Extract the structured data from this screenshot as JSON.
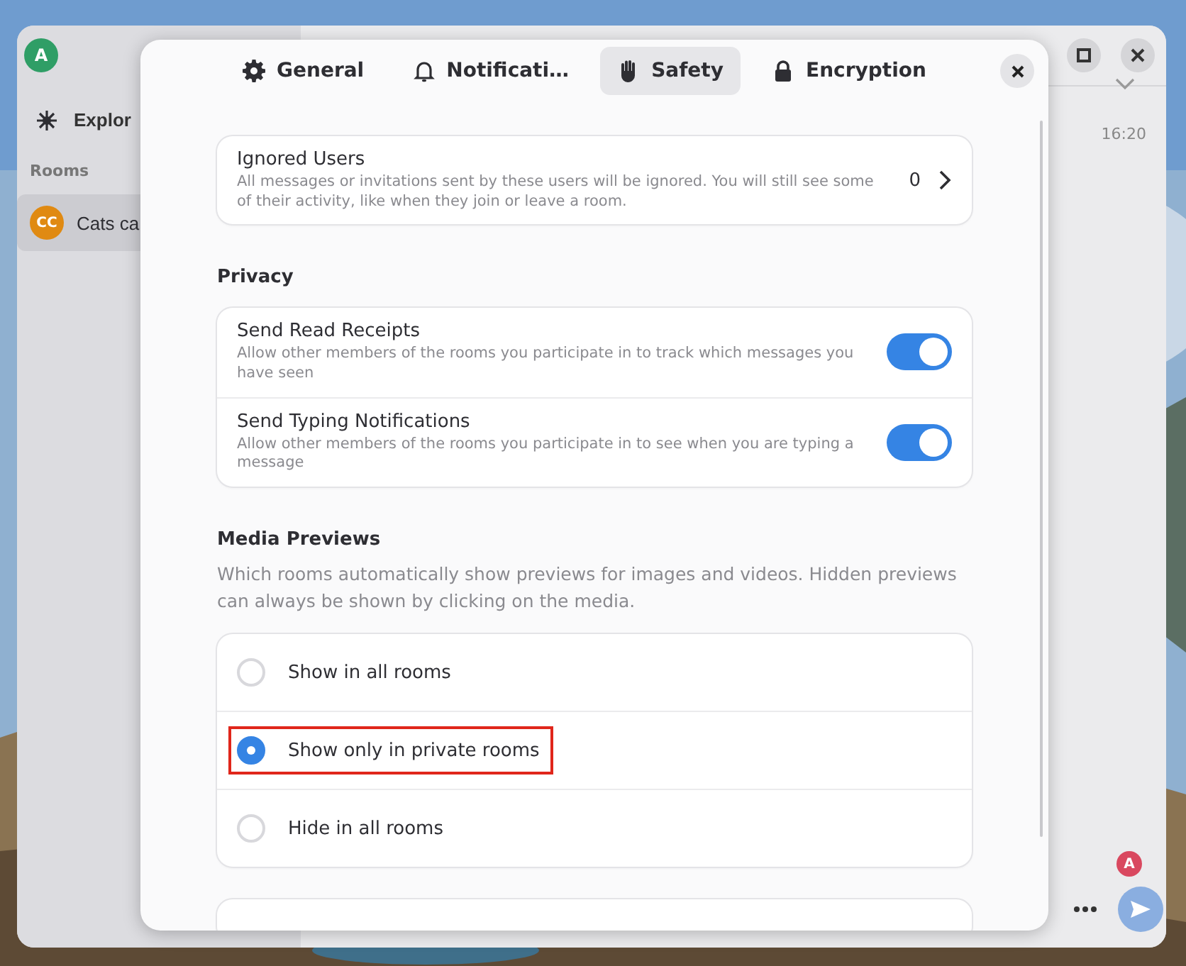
{
  "sidebar": {
    "avatar": "A",
    "explore": "Explor",
    "section": "Rooms",
    "rooms": [
      {
        "initials": "CC",
        "name": "Cats ca",
        "selected": true
      }
    ]
  },
  "chat": {
    "time": "16:20",
    "avatar": "A"
  },
  "dialog": {
    "tabs": [
      {
        "label": "General",
        "kind": "gear",
        "selected": false
      },
      {
        "label": "Notificati…",
        "kind": "bell",
        "selected": false
      },
      {
        "label": "Safety",
        "kind": "hand",
        "selected": true
      },
      {
        "label": "Encryption",
        "kind": "lock",
        "selected": false
      }
    ],
    "ignored": {
      "title": "Ignored Users",
      "subtitle": "All messages or invitations sent by these users will be ignored. You will still see some of their activity, like when they join or leave a room.",
      "count": "0"
    },
    "privacy": {
      "heading": "Privacy",
      "items": [
        {
          "title": "Send Read Receipts",
          "subtitle": "Allow other members of the rooms you participate in to track which messages you have seen",
          "on": true
        },
        {
          "title": "Send Typing Notifications",
          "subtitle": "Allow other members of the rooms you participate in to see when you are typing a message",
          "on": true
        }
      ]
    },
    "media": {
      "heading": "Media Previews",
      "description": "Which rooms automatically show previews for images and videos. Hidden previews can always be shown by clicking on the media.",
      "options": [
        {
          "label": "Show in all rooms",
          "selected": false,
          "highlighted": false
        },
        {
          "label": "Show only in private rooms",
          "selected": true,
          "highlighted": true
        },
        {
          "label": "Hide in all rooms",
          "selected": false,
          "highlighted": false
        }
      ]
    }
  }
}
